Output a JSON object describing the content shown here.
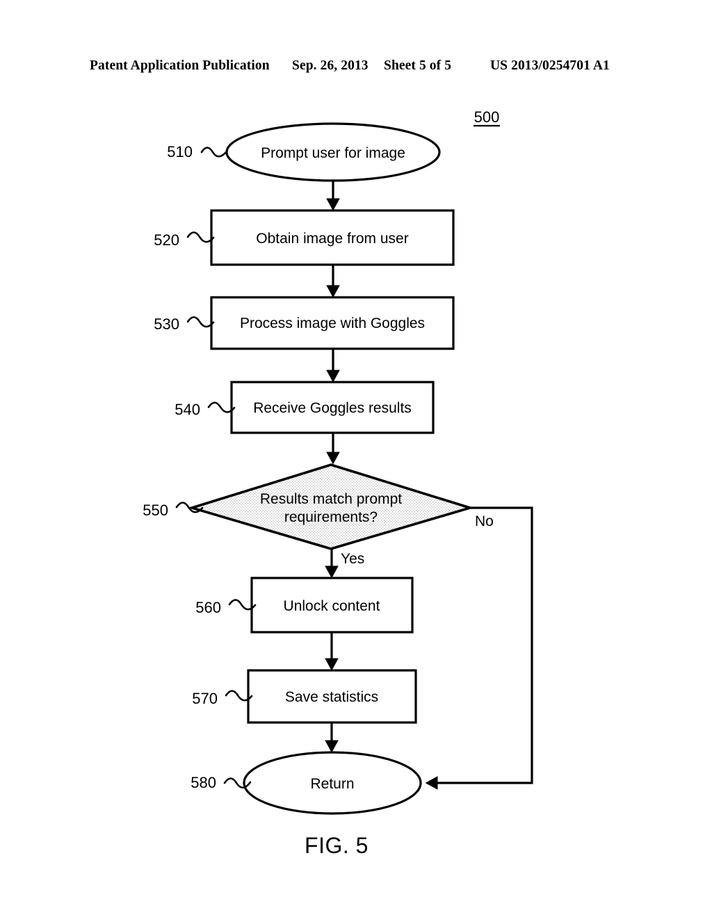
{
  "header": {
    "publication": "Patent Application Publication",
    "date": "Sep. 26, 2013",
    "sheet": "Sheet 5 of 5",
    "patent_number": "US 2013/0254701 A1"
  },
  "figure": {
    "caption": "FIG. 5",
    "diagram_number": "500",
    "nodes": [
      {
        "ref": "510",
        "label": "Prompt user for image",
        "shape": "ellipse"
      },
      {
        "ref": "520",
        "label": "Obtain image from user",
        "shape": "rect"
      },
      {
        "ref": "530",
        "label": "Process image with Goggles",
        "shape": "rect"
      },
      {
        "ref": "540",
        "label": "Receive Goggles results",
        "shape": "rect"
      },
      {
        "ref": "550",
        "label_line1": "Results match prompt",
        "label_line2": "requirements?",
        "shape": "diamond"
      },
      {
        "ref": "560",
        "label": "Unlock content",
        "shape": "rect"
      },
      {
        "ref": "570",
        "label": "Save statistics",
        "shape": "rect"
      },
      {
        "ref": "580",
        "label": "Return",
        "shape": "ellipse"
      }
    ],
    "branches": {
      "yes": "Yes",
      "no": "No"
    },
    "colors": {
      "stroke": "#000000",
      "fill": "#ffffff",
      "decision_fill": "#ececec",
      "background": "#ffffff"
    }
  }
}
